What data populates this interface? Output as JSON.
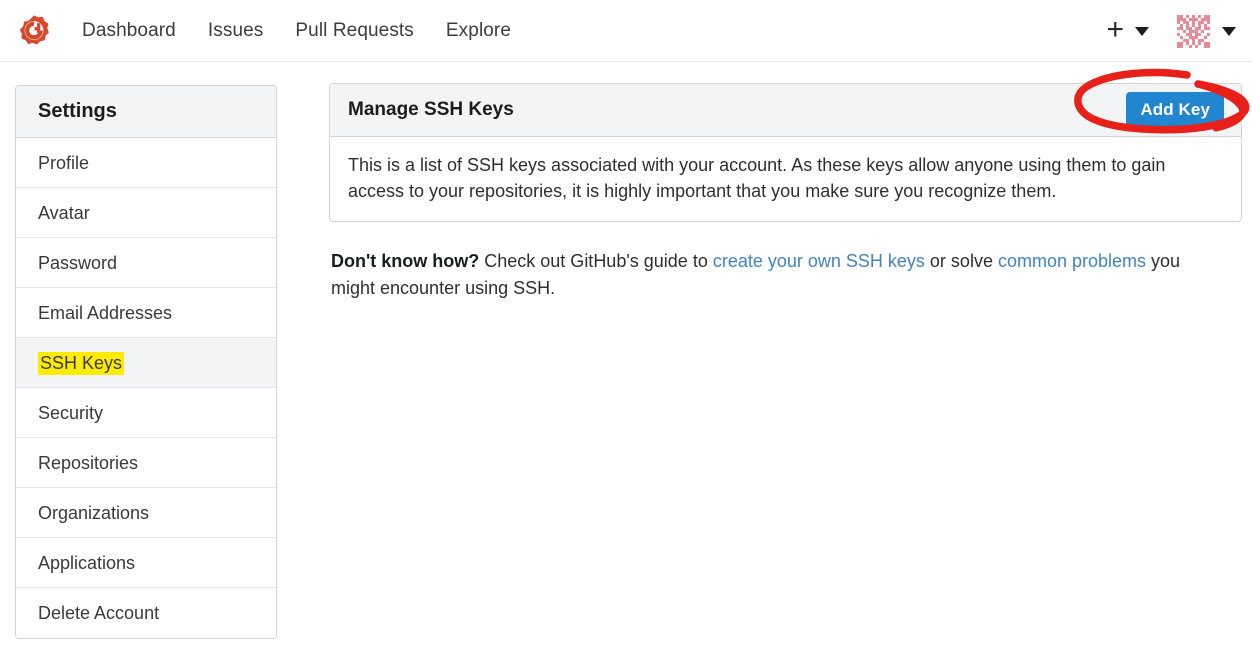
{
  "navbar": {
    "logo_icon": "gitea-logo-icon",
    "links": [
      {
        "label": "Dashboard",
        "name": "nav-link-dashboard"
      },
      {
        "label": "Issues",
        "name": "nav-link-issues"
      },
      {
        "label": "Pull Requests",
        "name": "nav-link-pull-requests"
      },
      {
        "label": "Explore",
        "name": "nav-link-explore"
      }
    ],
    "create_icon": "plus-icon",
    "create_caret_icon": "chevron-down-icon",
    "avatar_icon": "avatar-identicon",
    "avatar_caret_icon": "chevron-down-icon"
  },
  "sidebar": {
    "title": "Settings",
    "items": [
      {
        "label": "Profile",
        "name": "sidebar-item-profile",
        "active": false
      },
      {
        "label": "Avatar",
        "name": "sidebar-item-avatar",
        "active": false
      },
      {
        "label": "Password",
        "name": "sidebar-item-password",
        "active": false
      },
      {
        "label": "Email Addresses",
        "name": "sidebar-item-email-addresses",
        "active": false
      },
      {
        "label": "SSH Keys",
        "name": "sidebar-item-ssh-keys",
        "active": true
      },
      {
        "label": "Security",
        "name": "sidebar-item-security",
        "active": false
      },
      {
        "label": "Repositories",
        "name": "sidebar-item-repositories",
        "active": false
      },
      {
        "label": "Organizations",
        "name": "sidebar-item-organizations",
        "active": false
      },
      {
        "label": "Applications",
        "name": "sidebar-item-applications",
        "active": false
      },
      {
        "label": "Delete Account",
        "name": "sidebar-item-delete-account",
        "active": false
      }
    ]
  },
  "main": {
    "panel_title": "Manage SSH Keys",
    "add_key_label": "Add Key",
    "description": "This is a list of SSH keys associated with your account. As these keys allow anyone using them to gain access to your repositories, it is highly important that you make sure you recognize them.",
    "footer": {
      "lead": "Don't know how?",
      "text_1": " Check out GitHub's guide to ",
      "link_1": "create your own SSH keys",
      "text_2": " or solve ",
      "link_2": "common problems",
      "text_3": " you might encounter using SSH."
    }
  },
  "annotation": {
    "type": "hand-drawn-ellipse",
    "color": "#e8201a",
    "target": "Add Key"
  },
  "colors": {
    "accent_blue": "#2185d0",
    "link_blue": "#4183c4",
    "highlight_yellow": "#ffeb00",
    "panel_header_gray": "#f3f4f5",
    "border_gray": "#d4d4d5",
    "logo_orange": "#d9482a",
    "annotation_red": "#e8201a"
  }
}
